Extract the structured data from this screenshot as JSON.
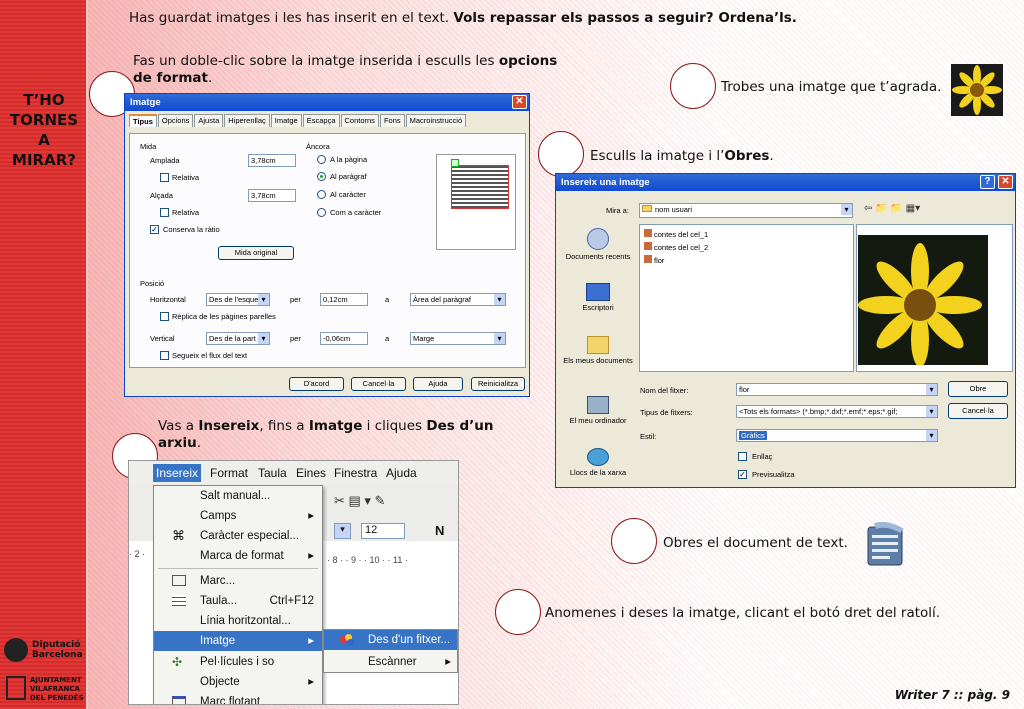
{
  "sidebar": {
    "title_lines": [
      "T’HO",
      "TORNES",
      "A",
      "MIRAR?"
    ],
    "logo1_lines": [
      "Diputació",
      "Barcelona"
    ],
    "logo2_lines": [
      "AJUNTAMENT",
      "VILAFRANCA",
      "DEL PENEDÈS"
    ]
  },
  "header": {
    "text": "Has guardat imatges i les has inserit en el text. ",
    "bold": "Vols repassar els passos a seguir? Ordena’ls."
  },
  "steps": {
    "s1": {
      "pre": "Fas un doble-clic sobre la imatge inserida i esculls les ",
      "b1": "opcions",
      "mid": "",
      "b2": "de format",
      "post": "."
    },
    "s2": {
      "pre": "Trobes una imatge que t’agrada."
    },
    "s3": {
      "pre": "Esculls la imatge i l’",
      "b1": "Obres",
      "post": "."
    },
    "s4": {
      "pre": "Vas a ",
      "b1": "Insereix",
      "m1": ", fins a ",
      "b2": "Imatge",
      "m2": " i cliques ",
      "b3": "Des d’un",
      "b4": "arxiu",
      "post": "."
    },
    "s5": {
      "pre": "Obres el document de text."
    },
    "s6": {
      "pre": "Anomenes i deses la imatge, clicant el botó dret del ratolí."
    }
  },
  "imatge_dialog": {
    "title": "Imatge",
    "close": "✕",
    "tabs": [
      "Tipus",
      "Opcions",
      "Ajusta",
      "Hiperenllaç",
      "Imatge",
      "Escapça",
      "Contorns",
      "Fons",
      "Macroinstrucció"
    ],
    "mida": "Mida",
    "amplada": "Amplada",
    "amplada_val": "3,78cm",
    "relativa": "Relativa",
    "alcada": "Alçada",
    "alcada_val": "3,78cm",
    "conserva": "Conserva la ràtio",
    "mida_original": "Mida original",
    "ancora": "Àncora",
    "ancora_opts": [
      "A la pàgina",
      "Al paràgraf",
      "Al caràcter",
      "Com a caràcter"
    ],
    "posicio": "Posició",
    "horitzontal": "Horitzontal",
    "h_val": "Des de l'esquerra",
    "per": "per",
    "h_num": "0,12cm",
    "a": "a",
    "h_a": "Àrea del paràgraf",
    "replica": "Rèplica de les pàgines parelles",
    "vertical": "Vertical",
    "v_val": "Des de la part superior",
    "v_num": "-0,06cm",
    "v_a": "Marge",
    "segueix": "Segueix el flux del text",
    "buttons": [
      "D'acord",
      "Cancel·la",
      "Ajuda",
      "Reinicialitza"
    ],
    "check": "✓"
  },
  "insereix_dialog": {
    "title": "Insereix una imatge",
    "help": "?",
    "close": "✕",
    "mira": "Mira a:",
    "folder": "nom usuari",
    "places": [
      "Documents recents",
      "Escriptori",
      "Els meus documents",
      "El meu ordinador",
      "Llocs de la xarxa"
    ],
    "files": [
      "contes del cel_1",
      "contes del cel_2",
      "flor"
    ],
    "nom": "Nom del fitxer:",
    "nom_val": "flor",
    "tipus": "Tipus de fitxers:",
    "tipus_val": "<Tots els formats> (*.bmp;*.dxf;*.emf;*.eps;*.gif;",
    "estil": "Estil:",
    "estil_val": "Gràfics",
    "enllac": "Enllaç",
    "previsualitza": "Previsualitza",
    "obre": "Obre",
    "cancel": "Cancel·la",
    "check": "✓"
  },
  "menu": {
    "bar": [
      "Insereix",
      "Format",
      "Taula",
      "Eines",
      "Finestra",
      "Ajuda"
    ],
    "items": [
      "Salt manual...",
      "Camps",
      "Caràcter especial...",
      "Marca de format",
      "Marc...",
      "Taula...",
      "Línia horitzontal...",
      "Imatge",
      "Pel·lícules i so",
      "Objecte",
      "Marc flotant"
    ],
    "taula_key": "Ctrl+F12",
    "sub": [
      "Des d'un fitxer...",
      "Escànner"
    ],
    "fontsize": "12",
    "ruler": "· 2 ·",
    "ruler2": "· 8 · · 9 · · 10 · · 11 ·"
  },
  "footer": "Writer 7 :: pàg. 9",
  "colors": {
    "accent": "#e03737",
    "highlight": "#3874c6"
  }
}
